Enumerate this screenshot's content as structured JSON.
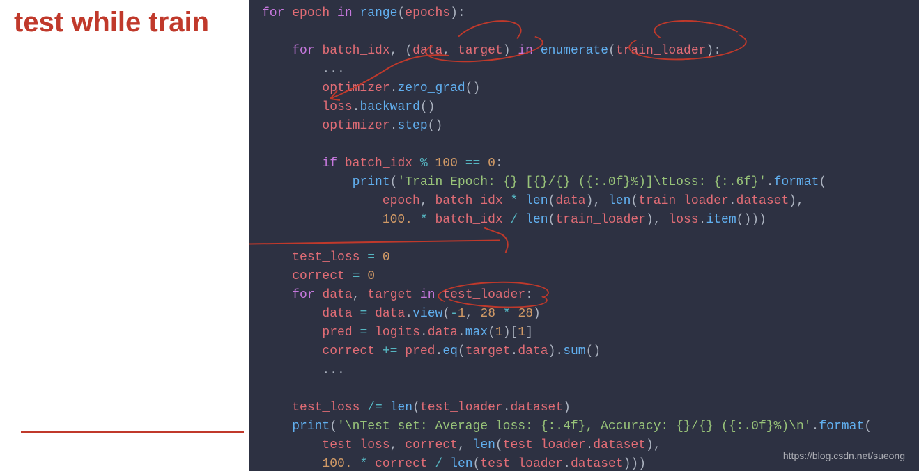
{
  "slide": {
    "title": "test while train"
  },
  "code": {
    "line1": {
      "kw1": "for",
      "var1": "epoch",
      "kw2": "in",
      "fn1": "range",
      "p1": "(",
      "var2": "epochs",
      "p2": "):"
    },
    "line2_blank": "",
    "line3": {
      "kw1": "for",
      "var1": "batch_idx",
      "op1": ",",
      "p1": " (",
      "var2": "data",
      "op2": ",",
      "var3": "target",
      "p2": ")",
      "kw2": "in",
      "fn1": "enumerate",
      "p3": "(",
      "var4": "train_loader",
      "p4": "):"
    },
    "line4": {
      "txt": "..."
    },
    "line5": {
      "var1": "optimizer",
      "op1": ".",
      "fn1": "zero_grad",
      "p1": "()"
    },
    "line6": {
      "var1": "loss",
      "op1": ".",
      "fn1": "backward",
      "p1": "()"
    },
    "line7": {
      "var1": "optimizer",
      "op1": ".",
      "fn1": "step",
      "p1": "()"
    },
    "line8_blank": "",
    "line9": {
      "kw1": "if",
      "var1": "batch_idx",
      "op1": "%",
      "num1": "100",
      "op2": "==",
      "num2": "0",
      "p1": ":"
    },
    "line10": {
      "fn1": "print",
      "p1": "(",
      "str1": "'Train Epoch: {} [{}/{} ({:.0f}%)]\\tLoss: {:.6f}'",
      "op1": ".",
      "fn2": "format",
      "p2": "("
    },
    "line11": {
      "var1": "epoch",
      "op1": ",",
      "var2": "batch_idx",
      "op2": "*",
      "fn1": "len",
      "p1": "(",
      "var3": "data",
      "p2": "),",
      "fn2": "len",
      "p3": "(",
      "var4": "train_loader",
      "op3": ".",
      "attr1": "dataset",
      "p4": "),"
    },
    "line12": {
      "num1": "100.",
      "op1": "*",
      "var1": "batch_idx",
      "op2": "/",
      "fn1": "len",
      "p1": "(",
      "var2": "train_loader",
      "p2": "),",
      "var3": "loss",
      "op3": ".",
      "fn2": "item",
      "p3": "()))"
    },
    "line13_blank": "",
    "line14": {
      "var1": "test_loss",
      "op1": "=",
      "num1": "0"
    },
    "line15": {
      "var1": "correct",
      "op1": "=",
      "num1": "0"
    },
    "line16": {
      "kw1": "for",
      "var1": "data",
      "op1": ",",
      "var2": "target",
      "kw2": "in",
      "var3": "test_loader",
      "p1": ":"
    },
    "line17": {
      "var1": "data",
      "op1": "=",
      "var2": "data",
      "op2": ".",
      "fn1": "view",
      "p1": "(",
      "op3": "-",
      "num1": "1",
      "op4": ",",
      "num2": "28",
      "op5": "*",
      "num3": "28",
      "p2": ")"
    },
    "line18": {
      "var1": "pred",
      "op1": "=",
      "var2": "logits",
      "op2": ".",
      "attr1": "data",
      "op3": ".",
      "fn1": "max",
      "p1": "(",
      "num1": "1",
      "p2": ")[",
      "num2": "1",
      "p3": "]"
    },
    "line19": {
      "var1": "correct",
      "op1": "+=",
      "var2": "pred",
      "op2": ".",
      "fn1": "eq",
      "p1": "(",
      "var3": "target",
      "op3": ".",
      "attr1": "data",
      "p2": ").",
      "fn2": "sum",
      "p3": "()"
    },
    "line20": {
      "txt": "..."
    },
    "line21_blank": "",
    "line22": {
      "var1": "test_loss",
      "op1": "/=",
      "fn1": "len",
      "p1": "(",
      "var2": "test_loader",
      "op2": ".",
      "attr1": "dataset",
      "p2": ")"
    },
    "line23": {
      "fn1": "print",
      "p1": "(",
      "str1": "'\\nTest set: Average loss: {:.4f}, Accuracy: {}/{} ({:.0f}%)\\n'",
      "op1": ".",
      "fn2": "format",
      "p2": "("
    },
    "line24": {
      "var1": "test_loss",
      "op1": ",",
      "var2": "correct",
      "op2": ",",
      "fn1": "len",
      "p1": "(",
      "var3": "test_loader",
      "op3": ".",
      "attr1": "dataset",
      "p2": "),"
    },
    "line25": {
      "num1": "100.",
      "op1": "*",
      "var1": "correct",
      "op2": "/",
      "fn1": "len",
      "p1": "(",
      "var2": "test_loader",
      "op3": ".",
      "attr1": "dataset",
      "p2": ")))"
    }
  },
  "watermark": "https://blog.csdn.net/sueong"
}
